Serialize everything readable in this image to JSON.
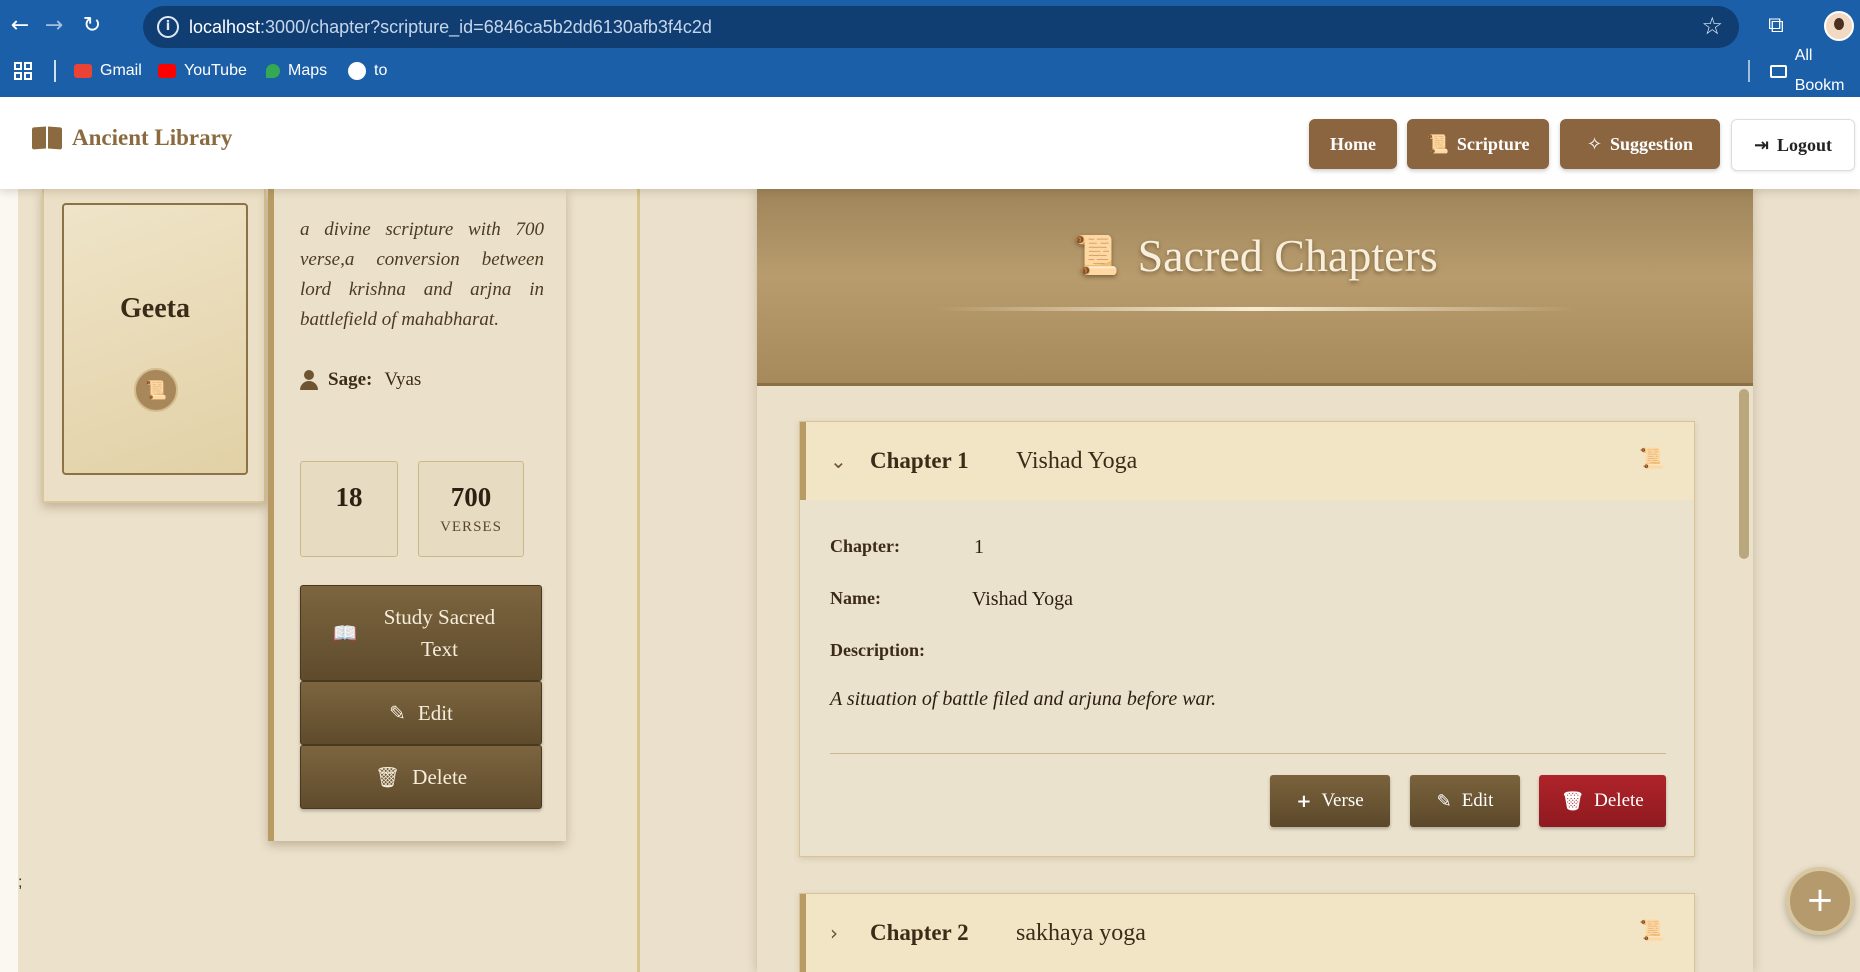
{
  "browser": {
    "url_host": "localhost",
    "url_rest": ":3000/chapter?scripture_id=6846ca5b2dd6130afb3f4c2d",
    "bookmarks": [
      {
        "label": "Gmail",
        "icon": "gmail-icon",
        "color": "#ea4335"
      },
      {
        "label": "YouTube",
        "icon": "youtube-icon",
        "color": "#ff0000"
      },
      {
        "label": "Maps",
        "icon": "maps-icon",
        "color": "#34a853"
      },
      {
        "label": "to",
        "icon": "globe-icon",
        "color": "#ffffff"
      }
    ],
    "all_bookmarks": "All Bookm"
  },
  "header": {
    "brand": "Ancient Library",
    "nav": [
      {
        "label": "Home",
        "icon": ""
      },
      {
        "label": "Scripture",
        "icon": "scroll-icon"
      },
      {
        "label": "Suggestion",
        "icon": "sparkle-icon"
      },
      {
        "label": "Logout",
        "icon": "logout-icon"
      }
    ]
  },
  "scripture": {
    "title": "Geeta",
    "description": "a divine scripture with 700 verse,a conversion between lord krishna and arjna in battlefield of mahabharat.",
    "sage_label": "Sage:",
    "sage": "Vyas",
    "stats": [
      {
        "value": "18",
        "label": ""
      },
      {
        "value": "700",
        "label": "VERSES"
      }
    ],
    "buttons": {
      "study": "Study Sacred Text",
      "edit": "Edit",
      "delete": "Delete"
    }
  },
  "chapters_panel": {
    "title": "Sacred Chapters",
    "labels": {
      "chapter": "Chapter:",
      "name": "Name:",
      "description": "Description:"
    },
    "chapters": [
      {
        "heading": "Chapter 1",
        "name": "Vishad Yoga",
        "number": "1",
        "description": "A situation of battle filed and arjuna before war.",
        "expanded": true
      },
      {
        "heading": "Chapter 2",
        "name": "sakhaya yoga",
        "expanded": false
      }
    ],
    "actions": {
      "verse": "Verse",
      "edit": "Edit",
      "delete": "Delete"
    }
  },
  "misc": {
    "stray_text": ";",
    "fab_symbol": "+"
  },
  "colors": {
    "brand": "#8b6540",
    "delete": "#b0232a",
    "browser": "#1b5fa8"
  }
}
